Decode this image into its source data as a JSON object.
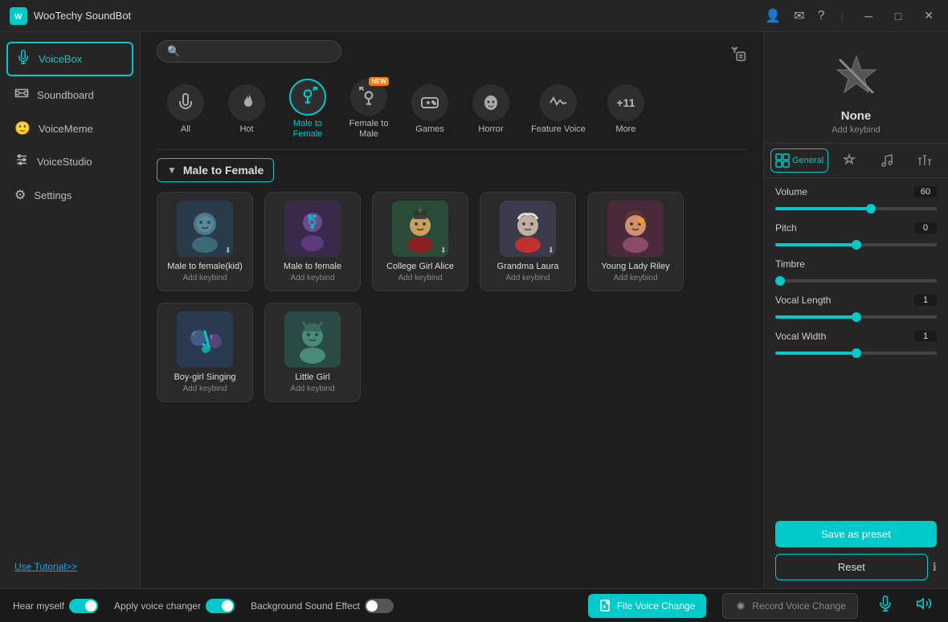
{
  "app": {
    "title": "WooTechy SoundBot",
    "logo": "W"
  },
  "titlebar": {
    "icons": [
      "user",
      "mail",
      "question"
    ],
    "window_btns": [
      "minimize",
      "maximize",
      "close"
    ]
  },
  "sidebar": {
    "items": [
      {
        "id": "voicebox",
        "label": "VoiceBox",
        "icon": "🎙",
        "active": true
      },
      {
        "id": "soundboard",
        "label": "Soundboard",
        "icon": "🎧"
      },
      {
        "id": "voicememe",
        "label": "VoiceMeme",
        "icon": "🙂"
      },
      {
        "id": "voicestudio",
        "label": "VoiceStudio",
        "icon": "🎛"
      },
      {
        "id": "settings",
        "label": "Settings",
        "icon": "⚙"
      }
    ],
    "tutorial_link": "Use Tutorial>>"
  },
  "search": {
    "placeholder": ""
  },
  "categories": [
    {
      "id": "all",
      "label": "All",
      "icon": "🎙",
      "active": false
    },
    {
      "id": "hot",
      "label": "Hot",
      "icon": "🔥",
      "active": false
    },
    {
      "id": "male-to-female",
      "label": "Male to\nFemale",
      "icon": "⚧",
      "active": true,
      "new": false
    },
    {
      "id": "female-to-male",
      "label": "Female to\nMale",
      "icon": "⚥",
      "active": false,
      "new": true
    },
    {
      "id": "games",
      "label": "Games",
      "icon": "🎮",
      "active": false
    },
    {
      "id": "horror",
      "label": "Horror",
      "icon": "👻",
      "active": false
    },
    {
      "id": "feature-voice",
      "label": "Feature Voice",
      "icon": "〰",
      "active": false
    },
    {
      "id": "more",
      "label": "+11\nMore",
      "icon": "",
      "active": false
    }
  ],
  "section": {
    "title": "Male to Female"
  },
  "voices": [
    {
      "id": 1,
      "name": "Male to female(kid)",
      "keybind": "Add keybind",
      "color": "blue",
      "emoji": "🤖",
      "has_download": true
    },
    {
      "id": 2,
      "name": "Male to female",
      "keybind": "Add keybind",
      "color": "purple",
      "emoji": "⚧",
      "has_download": false
    },
    {
      "id": 3,
      "name": "College Girl Alice",
      "keybind": "Add keybind",
      "color": "green",
      "emoji": "👩‍🎓",
      "has_download": true
    },
    {
      "id": 4,
      "name": "Grandma Laura",
      "keybind": "Add keybind",
      "color": "gray",
      "emoji": "👵",
      "has_download": true
    },
    {
      "id": 5,
      "name": "Young Lady Riley",
      "keybind": "Add keybind",
      "color": "pink",
      "emoji": "👩",
      "has_download": false
    },
    {
      "id": 6,
      "name": "Boy-girl Singing",
      "keybind": "Add keybind",
      "color": "boy",
      "emoji": "🎤",
      "has_download": false
    },
    {
      "id": 7,
      "name": "Little Girl",
      "keybind": "Add keybind",
      "color": "girl",
      "emoji": "👧",
      "has_download": false
    }
  ],
  "preset": {
    "label": "None",
    "keybind": "Add keybind"
  },
  "right_tabs": [
    {
      "id": "general",
      "label": "General",
      "icon": "⊞",
      "active": true
    },
    {
      "id": "effects",
      "label": "Effects",
      "icon": "✨",
      "active": false
    },
    {
      "id": "music",
      "label": "Music",
      "icon": "♪",
      "active": false
    },
    {
      "id": "equalizer",
      "label": "Equalizer",
      "icon": "🎚",
      "active": false
    }
  ],
  "controls": {
    "volume": {
      "label": "Volume",
      "value": "60",
      "pct": 60
    },
    "pitch": {
      "label": "Pitch",
      "value": "0",
      "pct": 50
    },
    "timbre": {
      "label": "Timbre"
    },
    "vocal_length": {
      "label": "Vocal Length",
      "value": "1",
      "pct": 55
    },
    "vocal_width": {
      "label": "Vocal Width",
      "value": "1",
      "pct": 55
    }
  },
  "buttons": {
    "save_preset": "Save as preset",
    "reset": "Reset"
  },
  "bottom_bar": {
    "hear_myself": {
      "label": "Hear myself",
      "on": true
    },
    "apply_voice_changer": {
      "label": "Apply voice changer",
      "on": true
    },
    "background_sound": {
      "label": "Background Sound Effect",
      "on": false
    },
    "file_voice_change": "File Voice Change",
    "record_voice_change": "Record Voice Change"
  }
}
